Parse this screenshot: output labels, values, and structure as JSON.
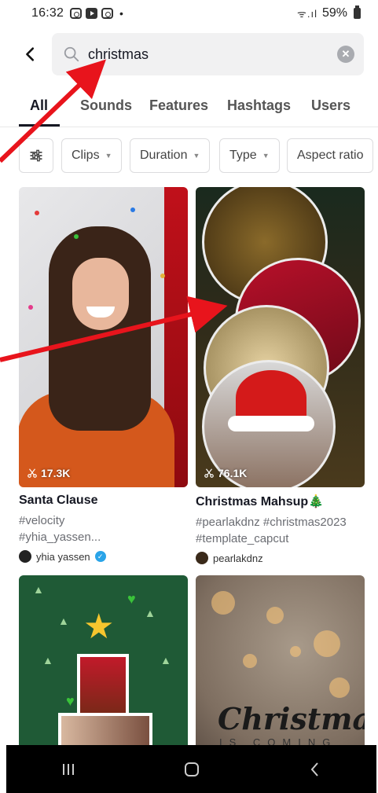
{
  "status_bar": {
    "time": "16:32",
    "dot": "•",
    "battery_text": "59%",
    "signal": "ᯤ.ıl"
  },
  "search": {
    "query": "christmas",
    "placeholder": ""
  },
  "tabs": [
    {
      "label": "All",
      "active": true
    },
    {
      "label": "Sounds",
      "active": false
    },
    {
      "label": "Features",
      "active": false
    },
    {
      "label": "Hashtags",
      "active": false
    },
    {
      "label": "Users",
      "active": false
    }
  ],
  "filters": [
    {
      "label": "Clips"
    },
    {
      "label": "Duration"
    },
    {
      "label": "Type"
    },
    {
      "label": "Aspect ratio"
    }
  ],
  "results": [
    {
      "views": "17.3K",
      "title": "Santa Clause",
      "tags_line1": "#velocity",
      "tags_line2": "#yhia_yassen...",
      "author": "yhia yassen",
      "verified": true
    },
    {
      "views": "76.1K",
      "title": "Christmas Mahsup🎄",
      "tags_line1": "#pearlakdnz #christmas2023",
      "tags_line2": "#template_capcut",
      "author": "pearlakdnz",
      "verified": false
    },
    {
      "views": "",
      "title": "",
      "author": ""
    },
    {
      "overlay_title": "Christmas",
      "overlay_subtitle": "IS COMING"
    }
  ],
  "colors": {
    "annotation_arrow": "#e8141c",
    "nav_bg": "#000000",
    "text_primary": "#161823",
    "text_secondary": "#6b6d73"
  }
}
